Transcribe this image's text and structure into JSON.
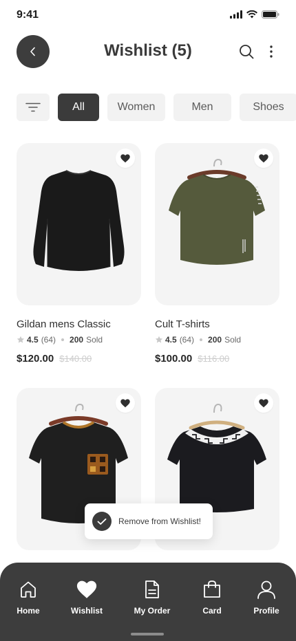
{
  "status_bar": {
    "time": "9:41"
  },
  "header": {
    "title": "Wishlist (5)"
  },
  "filters": {
    "chips": [
      {
        "label": "All",
        "active": true
      },
      {
        "label": "Women",
        "active": false
      },
      {
        "label": "Men",
        "active": false
      },
      {
        "label": "Shoes",
        "active": false
      }
    ]
  },
  "products": [
    {
      "name": "Gildan mens Classic",
      "rating": "4.5",
      "reviews": "(64)",
      "sold": "200",
      "sold_label": "Sold",
      "price": "$120.00",
      "old_price": "$140.00",
      "image": "black-long-sleeve-shirt",
      "wishlisted": true
    },
    {
      "name": "Cult T-shirts",
      "rating": "4.5",
      "reviews": "(64)",
      "sold": "200",
      "sold_label": "Sold",
      "price": "$100.00",
      "old_price": "$116.00",
      "image": "olive-tshirt-on-hanger",
      "wishlisted": true
    },
    {
      "image": "black-tshirt-with-pattern-pocket",
      "wishlisted": true
    },
    {
      "image": "black-tshirt-with-greek-key-collar",
      "wishlisted": true
    }
  ],
  "toast": {
    "message": "Remove from Wishlist!"
  },
  "bottom_nav": {
    "items": [
      {
        "label": "Home",
        "icon": "home-icon"
      },
      {
        "label": "Wishlist",
        "icon": "heart-icon"
      },
      {
        "label": "My Order",
        "icon": "document-icon"
      },
      {
        "label": "Card",
        "icon": "shopping-bag-icon"
      },
      {
        "label": "Profile",
        "icon": "user-icon"
      }
    ]
  },
  "colors": {
    "primary": "#3d3d3d",
    "chip_bg": "#f2f2f2",
    "card_bg": "#f4f4f4",
    "old_price": "#cdcdcd"
  }
}
